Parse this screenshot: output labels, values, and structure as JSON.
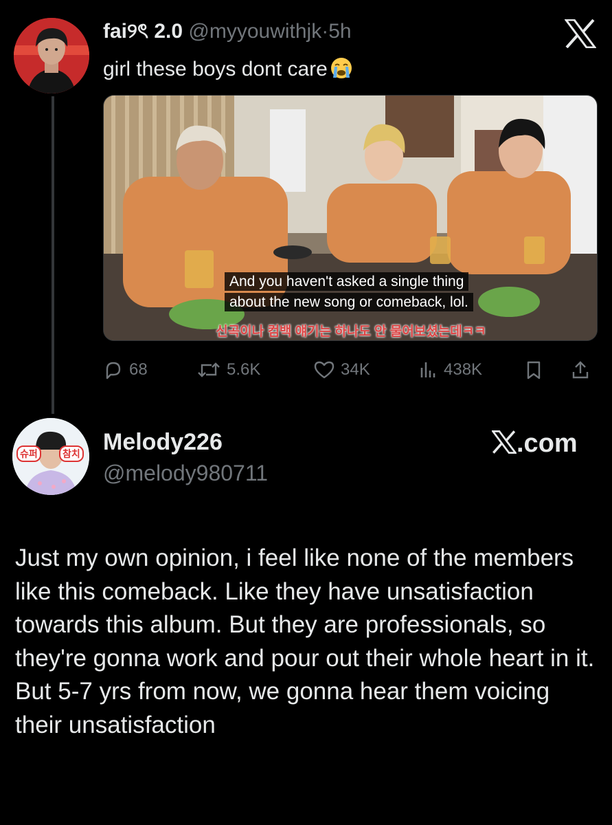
{
  "tweet1": {
    "name": "fai୨ৎ 2.0",
    "handle": "@myyouwithjk",
    "separator": "·",
    "time": "5h",
    "text": "girl these boys dont care",
    "emoji": "loudly-crying-face-icon",
    "media": {
      "subtitle_line1": "And you haven't asked a single thing",
      "subtitle_line2": "about the new song or comeback, lol.",
      "korean_subtitle": "신곡이나 컴백 얘기는 하나도 안 물어보셨는데ㅋㅋ"
    },
    "stats": {
      "replies": "68",
      "reposts": "5.6K",
      "likes": "34K",
      "views": "438K"
    }
  },
  "tweet2": {
    "name": "Melody226",
    "handle": "@melody980711",
    "avatar_tag_left": "슈퍼",
    "avatar_tag_right": "참치",
    "text": "Just my own opinion, i feel like none of the members like this comeback. Like they have unsatisfaction towards this album. But they are professionals, so they're gonna work and pour out their whole heart in it. But 5-7 yrs from now, we gonna hear them voicing their unsatisfaction"
  },
  "branding": {
    "x_com": ".com"
  },
  "colors": {
    "background": "#000000",
    "primary_text": "#e7e9ea",
    "secondary_text": "#71767b",
    "avatar1_bg": "#c62b2b",
    "shirt_orange": "#d98a4e"
  }
}
